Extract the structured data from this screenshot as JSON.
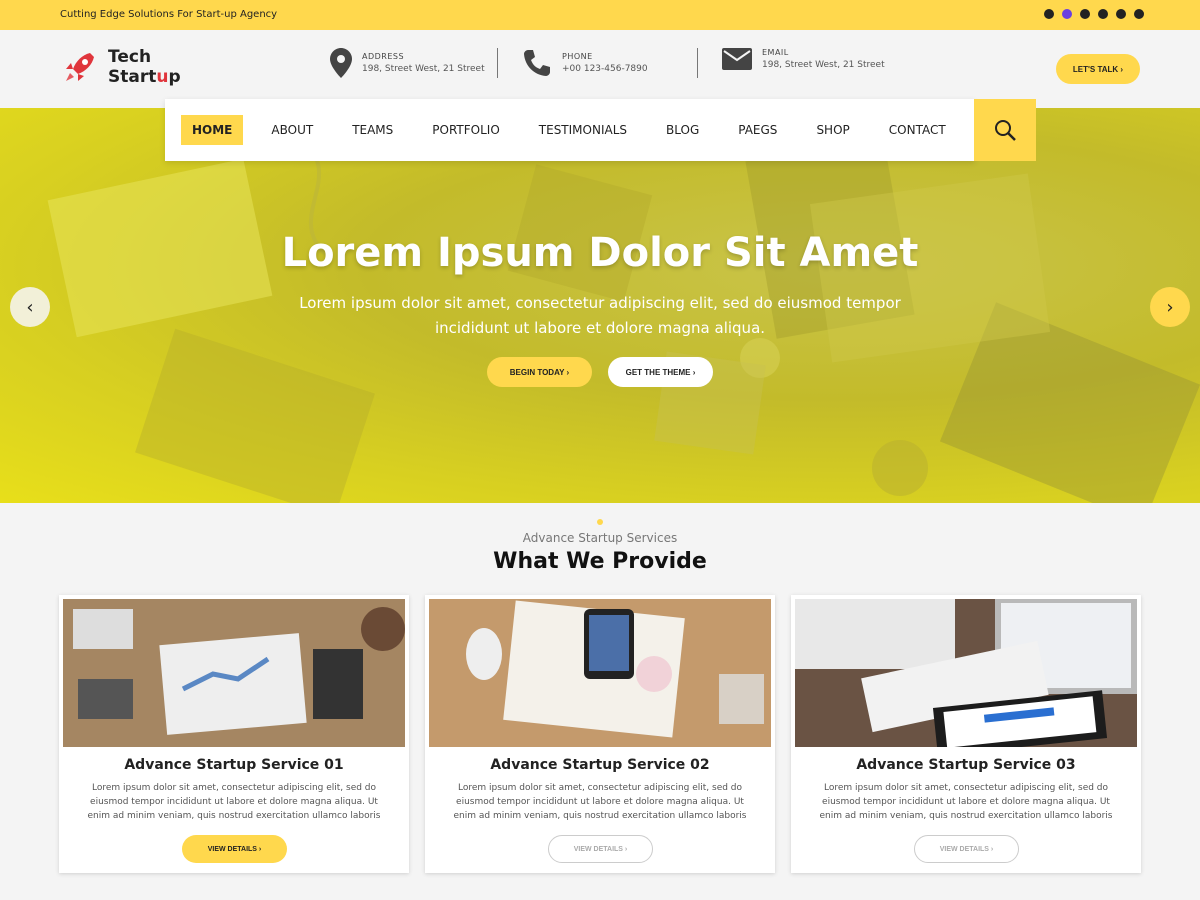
{
  "topbar": {
    "tagline": "Cutting Edge Solutions For Start-up Agency",
    "social_icons": [
      "facebook-icon",
      "twitter-icon",
      "linkedin-icon",
      "youtube-icon",
      "instagram-icon",
      "pinterest-icon"
    ]
  },
  "brand": {
    "line1": "Tech",
    "line2_a": "Start",
    "line2_b": "u",
    "line2_c": "p",
    "accent": "#e0353c"
  },
  "contact": {
    "address": {
      "label": "ADDRESS",
      "value": "198, Street West, 21 Street"
    },
    "phone": {
      "label": "PHONE",
      "value": "+00 123-456-7890"
    },
    "email": {
      "label": "EMAIL",
      "value": "198, Street West, 21 Street"
    }
  },
  "header": {
    "cta": "LET'S TALK ›"
  },
  "nav": {
    "items": [
      "HOME",
      "ABOUT",
      "TEAMS",
      "PORTFOLIO",
      "TESTIMONIALS",
      "BLOG",
      "PAEGS",
      "SHOP",
      "CONTACT"
    ],
    "active": "HOME"
  },
  "hero": {
    "title": "Lorem Ipsum Dolor Sit Amet",
    "subtitle": "Lorem ipsum dolor sit amet, consectetur adipiscing elit, sed do eiusmod tempor incididunt ut labore et dolore magna aliqua.",
    "btn_primary": "BEGIN TODAY ›",
    "btn_secondary": "GET THE THEME ›",
    "prev": "‹",
    "next": "›"
  },
  "services": {
    "subtitle": "Advance Startup Services",
    "title": "What We Provide",
    "cards": [
      {
        "title": "Advance Startup Service 01",
        "text": "Lorem ipsum dolor sit amet, consectetur adipiscing elit, sed do eiusmod tempor incididunt ut labore et dolore magna aliqua. Ut enim ad minim veniam, quis nostrud exercitation ullamco laboris",
        "button": "VIEW DETAILS ›"
      },
      {
        "title": "Advance Startup Service 02",
        "text": "Lorem ipsum dolor sit amet, consectetur adipiscing elit, sed do eiusmod tempor incididunt ut labore et dolore magna aliqua. Ut enim ad minim veniam, quis nostrud exercitation ullamco laboris",
        "button": "VIEW DETAILS ›"
      },
      {
        "title": "Advance Startup Service 03",
        "text": "Lorem ipsum dolor sit amet, consectetur adipiscing elit, sed do eiusmod tempor incididunt ut labore et dolore magna aliqua. Ut enim ad minim veniam, quis nostrud exercitation ullamco laboris",
        "button": "VIEW DETAILS ›"
      }
    ]
  },
  "colors": {
    "accent": "#ffd84d"
  }
}
